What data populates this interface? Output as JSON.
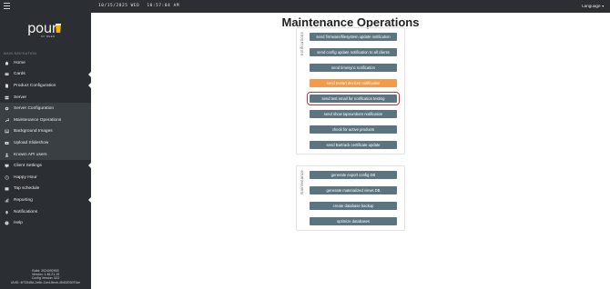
{
  "topbar": {
    "date": "10/15/2025 WED",
    "time": "10:57:04 AM",
    "language_label": "Language"
  },
  "sidebar": {
    "logo_text": "pour",
    "logo_subtext": "MY BEER",
    "heading": "Main Navigation",
    "items": [
      {
        "label": "Home",
        "icon": "home-icon",
        "arrow": false
      },
      {
        "label": "Cards",
        "icon": "card-icon",
        "arrow": true
      },
      {
        "label": "Product Configuration",
        "icon": "document-icon",
        "arrow": true
      },
      {
        "label": "Server",
        "icon": "server-icon",
        "arrow": false
      },
      {
        "label": "Server Configuration",
        "icon": "gear-icon",
        "arrow": false
      },
      {
        "label": "Maintenance Operations",
        "icon": "wrench-icon",
        "arrow": false
      },
      {
        "label": "Background Images",
        "icon": "image-icon",
        "arrow": false
      },
      {
        "label": "Upload Slideshow",
        "icon": "slideshow-icon",
        "arrow": false
      },
      {
        "label": "Known API users",
        "icon": "users-icon",
        "arrow": false
      },
      {
        "label": "Client Settings",
        "icon": "monitor-icon",
        "arrow": true
      },
      {
        "label": "Happy Hour",
        "icon": "clock-icon",
        "arrow": false
      },
      {
        "label": "Tap schedule",
        "icon": "calendar-icon",
        "arrow": false
      },
      {
        "label": "Reporting",
        "icon": "chart-icon",
        "arrow": true
      },
      {
        "label": "Notifications",
        "icon": "bell-icon",
        "arrow": false
      },
      {
        "label": "Help",
        "icon": "help-icon",
        "arrow": false
      }
    ],
    "build_lines": [
      "Build: 2024092903",
      "Version: 1.46.21.19",
      "Config Version: 522",
      "UUID: 4f72048A-2e6b-11e4-8ecb-4540203070ce"
    ]
  },
  "main": {
    "title": "Maintenance Operations",
    "notifications_label": "notifications",
    "maintenance_label": "maintenance",
    "notification_buttons": [
      "send firmware/filesystem update notification",
      "send config update notification to all clients",
      "send timesync notification",
      "send restart devices notification",
      "send test email for notification testing",
      "send show tapnumbers notification",
      "check for active products",
      "send Bartrack certificate update"
    ],
    "maintenance_buttons": [
      "generate export config DB",
      "generate materialized views DB",
      "create database backup",
      "optimize databases"
    ]
  },
  "colors": {
    "topbar_bg": "#2b2f33",
    "button_primary": "#5b7480",
    "button_warning": "#f49a4b",
    "selection_outline": "#e3262a"
  }
}
